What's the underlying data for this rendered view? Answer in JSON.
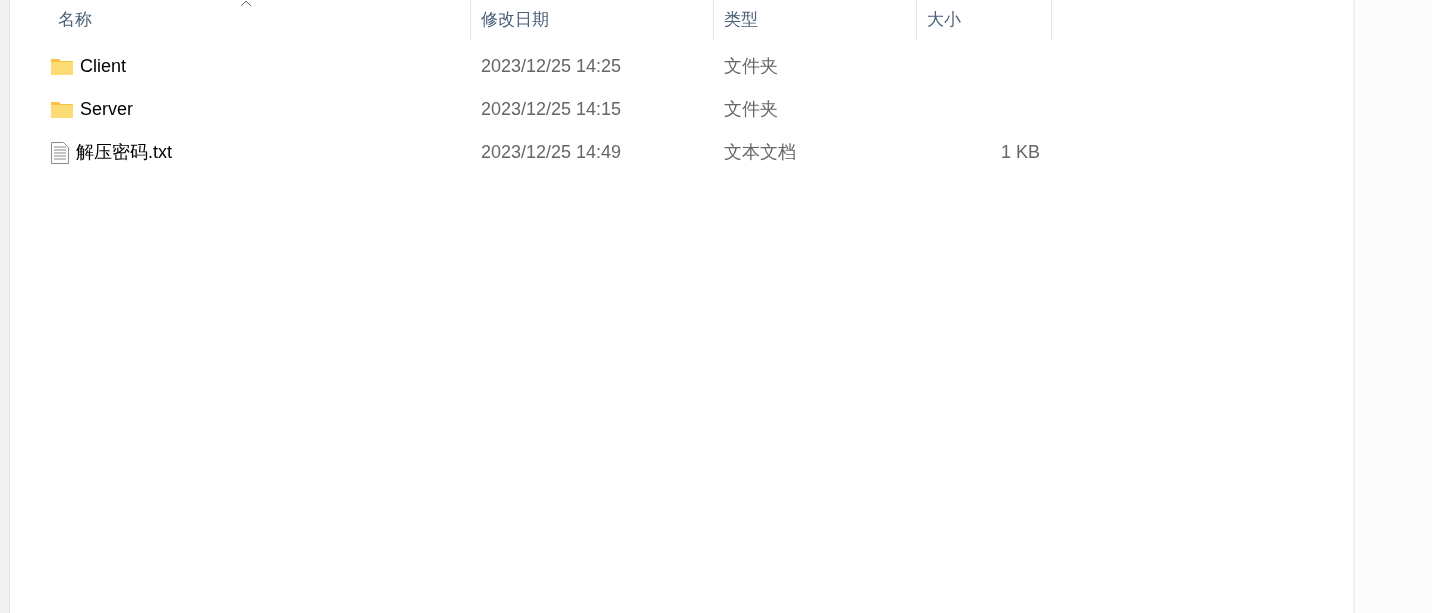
{
  "columns": [
    {
      "label": "名称",
      "sorted": true
    },
    {
      "label": "修改日期",
      "sorted": false
    },
    {
      "label": "类型",
      "sorted": false
    },
    {
      "label": "大小",
      "sorted": false
    }
  ],
  "files": [
    {
      "kind": "folder",
      "name": "Client",
      "modified": "2023/12/25 14:25",
      "type": "文件夹"
    },
    {
      "kind": "folder",
      "name": "Server",
      "modified": "2023/12/25 14:15",
      "type": "文件夹"
    },
    {
      "kind": "text",
      "name": "解压密码.txt",
      "modified": "2023/12/25 14:49",
      "type": "文本文档",
      "size": "1 KB"
    }
  ]
}
